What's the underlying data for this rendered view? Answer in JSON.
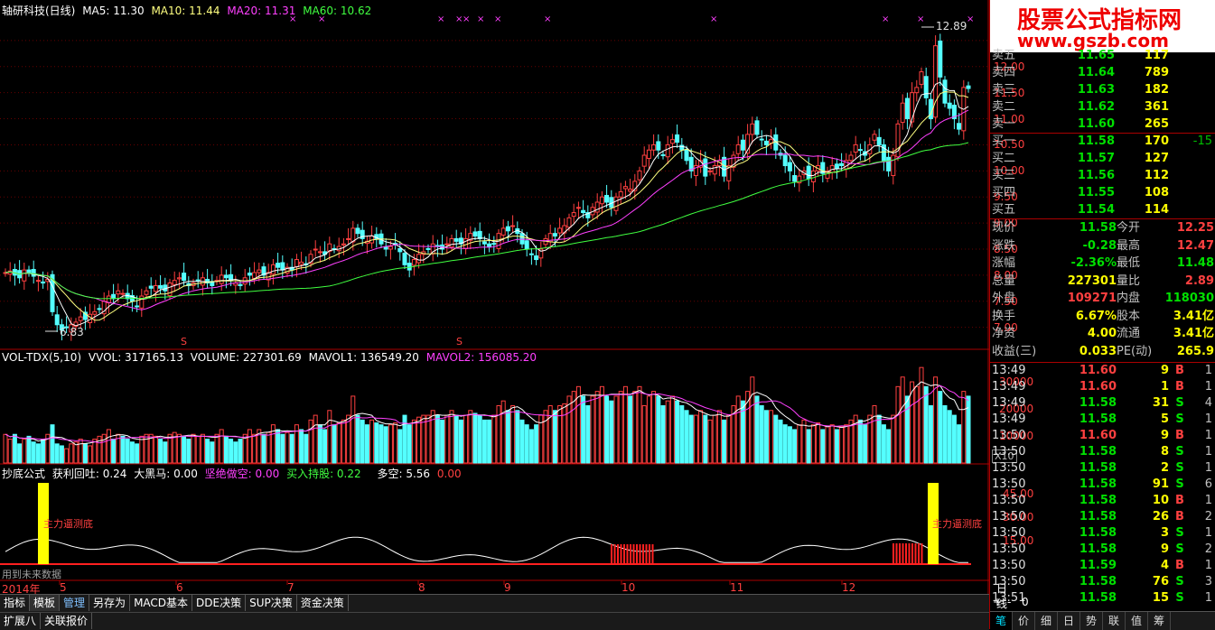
{
  "main_header": {
    "title": "轴研科技(日线)",
    "ma5": "MA5: 11.30",
    "ma10": "MA10: 11.44",
    "ma20": "MA20: 11.31",
    "ma60": "MA60: 10.62"
  },
  "vol_header": {
    "name": "VOL-TDX(5,10)",
    "vvol": "VVOL: 317165.13",
    "volume": "VOLUME: 227301.69",
    "mavol1": "MAVOL1: 136549.20",
    "mavol2": "MAVOL2: 156085.20"
  },
  "ind_header": {
    "name": "抄底公式",
    "profit": "获利回吐: 0.24",
    "black_horse": "大黑马: 0.00",
    "firm_short": "坚绝做空: 0.00",
    "buy_hold": "买入持股: 0.22",
    "long_short": "多空: 5.56",
    "zero": "0.00"
  },
  "labels": {
    "high": "12.89",
    "low": "6.83",
    "main_dip_left": "主力逼测底",
    "main_dip_right": "主力逼测底",
    "future_note": "用到未来数据",
    "x10": "X10",
    "period": "日线",
    "s_mark": "S"
  },
  "price_axis": [
    "12.50",
    "12.00",
    "11.50",
    "11.00",
    "10.50",
    "10.00",
    "9.50",
    "9.00",
    "8.50",
    "8.00",
    "7.50",
    "7.00"
  ],
  "price_axis_top": "1",
  "vol_axis": [
    "30000",
    "20000",
    "10000"
  ],
  "ind_axis": [
    "45.00",
    "30.00",
    "15.00"
  ],
  "time_axis": [
    "2014年",
    "5",
    "6",
    "7",
    "8",
    "9",
    "10",
    "11",
    "12"
  ],
  "tabs": [
    "指标",
    "模板",
    "管理",
    "另存为",
    "MACD基本",
    "DDE决策",
    "SUP决策",
    "资金决策"
  ],
  "tabs2": [
    "扩展八",
    "关联报价"
  ],
  "nav_controls": [
    "+",
    "-",
    "0"
  ],
  "watermark": {
    "line1": "股票公式指标网",
    "line2": "www.gszb.com"
  },
  "order_book": {
    "sell": [
      {
        "label": "卖五",
        "price": "11.65",
        "vol": "117"
      },
      {
        "label": "卖四",
        "price": "11.64",
        "vol": "789"
      },
      {
        "label": "卖三",
        "price": "11.63",
        "vol": "182"
      },
      {
        "label": "卖二",
        "price": "11.62",
        "vol": "361"
      },
      {
        "label": "卖一",
        "price": "11.60",
        "vol": "265"
      }
    ],
    "buy": [
      {
        "label": "买一",
        "price": "11.58",
        "vol": "170",
        "chg": "-15"
      },
      {
        "label": "买二",
        "price": "11.57",
        "vol": "127",
        "chg": ""
      },
      {
        "label": "买三",
        "price": "11.56",
        "vol": "112",
        "chg": ""
      },
      {
        "label": "买四",
        "price": "11.55",
        "vol": "108",
        "chg": ""
      },
      {
        "label": "买五",
        "price": "11.54",
        "vol": "114",
        "chg": ""
      }
    ]
  },
  "quote": [
    {
      "l1": "现价",
      "v1": "11.58",
      "l2": "今开",
      "v2": "12.25",
      "c1": "#00e000",
      "c2": "#ff4040"
    },
    {
      "l1": "涨跌",
      "v1": "-0.28",
      "l2": "最高",
      "v2": "12.47",
      "c1": "#00e000",
      "c2": "#ff4040"
    },
    {
      "l1": "涨幅",
      "v1": "-2.36%",
      "l2": "最低",
      "v2": "11.48",
      "c1": "#00e000",
      "c2": "#00e000"
    },
    {
      "l1": "总量",
      "v1": "227301",
      "l2": "量比",
      "v2": "2.89",
      "c1": "#ffff00",
      "c2": "#ff4040"
    },
    {
      "l1": "外盘",
      "v1": "109271",
      "l2": "内盘",
      "v2": "118030",
      "c1": "#ff4040",
      "c2": "#00e000"
    },
    {
      "l1": "换手",
      "v1": "6.67%",
      "l2": "股本",
      "v2": "3.41亿",
      "c1": "#ffff00",
      "c2": "#ffff00"
    },
    {
      "l1": "净资",
      "v1": "4.00",
      "l2": "流通",
      "v2": "3.41亿",
      "c1": "#ffff00",
      "c2": "#ffff00"
    },
    {
      "l1": "收益(三)",
      "v1": "0.033",
      "l2": "PE(动)",
      "v2": "265.9",
      "c1": "#ffff00",
      "c2": "#ffff00"
    }
  ],
  "ticks": [
    {
      "time": "13:49",
      "price": "11.60",
      "vol": "9",
      "side": "B",
      "cnt": "1"
    },
    {
      "time": "13:49",
      "price": "11.60",
      "vol": "1",
      "side": "B",
      "cnt": "1"
    },
    {
      "time": "13:49",
      "price": "11.58",
      "vol": "31",
      "side": "S",
      "cnt": "4"
    },
    {
      "time": "13:49",
      "price": "11.58",
      "vol": "5",
      "side": "S",
      "cnt": "1"
    },
    {
      "time": "13:50",
      "price": "11.60",
      "vol": "9",
      "side": "B",
      "cnt": "1"
    },
    {
      "time": "13:50",
      "price": "11.58",
      "vol": "8",
      "side": "S",
      "cnt": "1"
    },
    {
      "time": "13:50",
      "price": "11.58",
      "vol": "2",
      "side": "S",
      "cnt": "1"
    },
    {
      "time": "13:50",
      "price": "11.58",
      "vol": "91",
      "side": "S",
      "cnt": "6"
    },
    {
      "time": "13:50",
      "price": "11.58",
      "vol": "10",
      "side": "B",
      "cnt": "1"
    },
    {
      "time": "13:50",
      "price": "11.58",
      "vol": "26",
      "side": "B",
      "cnt": "2"
    },
    {
      "time": "13:50",
      "price": "11.58",
      "vol": "3",
      "side": "S",
      "cnt": "1"
    },
    {
      "time": "13:50",
      "price": "11.58",
      "vol": "9",
      "side": "S",
      "cnt": "2"
    },
    {
      "time": "13:50",
      "price": "11.59",
      "vol": "4",
      "side": "B",
      "cnt": "1"
    },
    {
      "time": "13:50",
      "price": "11.58",
      "vol": "76",
      "side": "S",
      "cnt": "3"
    },
    {
      "time": "13:51",
      "price": "11.58",
      "vol": "15",
      "side": "S",
      "cnt": "1"
    }
  ],
  "bottom_tabs": [
    "笔",
    "价",
    "细",
    "日",
    "势",
    "联",
    "值",
    "筹"
  ],
  "chart_data": {
    "type": "candlestick",
    "price_range": [
      6.7,
      13.0
    ],
    "closes": [
      8.05,
      8.08,
      8.0,
      7.95,
      8.1,
      8.05,
      7.98,
      7.9,
      7.85,
      7.92,
      7.3,
      7.05,
      6.95,
      7.0,
      7.05,
      7.1,
      7.2,
      7.15,
      7.25,
      7.3,
      7.35,
      7.5,
      7.6,
      7.55,
      7.7,
      7.65,
      7.55,
      7.5,
      7.4,
      7.6,
      7.7,
      7.75,
      7.8,
      7.75,
      7.7,
      7.85,
      7.9,
      7.95,
      7.9,
      7.8,
      7.85,
      7.9,
      7.95,
      7.85,
      7.8,
      7.9,
      8.0,
      7.95,
      7.9,
      7.85,
      7.8,
      7.95,
      8.0,
      8.05,
      8.1,
      8.0,
      8.05,
      8.2,
      8.15,
      8.1,
      8.15,
      8.1,
      8.3,
      8.25,
      8.2,
      8.4,
      8.5,
      8.45,
      8.4,
      8.6,
      8.5,
      8.55,
      8.6,
      8.7,
      8.9,
      8.8,
      8.7,
      8.65,
      8.75,
      8.7,
      8.6,
      8.5,
      8.55,
      8.6,
      8.45,
      8.2,
      8.1,
      8.3,
      8.4,
      8.45,
      8.5,
      8.6,
      8.55,
      8.5,
      8.6,
      8.7,
      8.65,
      8.6,
      8.7,
      8.8,
      8.75,
      8.7,
      8.6,
      8.55,
      8.6,
      8.8,
      8.9,
      8.85,
      8.95,
      8.8,
      8.6,
      8.5,
      8.4,
      8.3,
      8.5,
      8.7,
      8.8,
      8.75,
      8.9,
      8.95,
      9.1,
      9.2,
      9.3,
      9.2,
      9.1,
      9.3,
      9.4,
      9.5,
      9.4,
      9.3,
      9.5,
      9.6,
      9.7,
      9.65,
      9.8,
      10.0,
      10.3,
      10.4,
      10.5,
      10.4,
      10.3,
      10.5,
      10.6,
      10.55,
      10.4,
      10.2,
      10.0,
      10.1,
      10.2,
      9.9,
      10.0,
      10.1,
      10.2,
      9.9,
      10.1,
      10.3,
      10.5,
      10.4,
      10.7,
      10.9,
      10.7,
      10.6,
      10.5,
      10.6,
      10.4,
      10.3,
      10.1,
      10.0,
      9.8,
      9.9,
      10.0,
      9.85,
      10.0,
      10.1,
      9.95,
      10.0,
      10.1,
      10.05,
      10.1,
      10.2,
      10.3,
      10.5,
      10.4,
      10.3,
      10.5,
      10.7,
      10.5,
      10.2,
      10.0,
      10.3,
      10.9,
      11.3,
      11.0,
      11.5,
      11.6,
      11.9,
      11.4,
      11.0,
      12.4,
      11.8,
      11.3,
      11.2,
      11.0,
      10.8,
      11.6,
      11.58
    ],
    "series": [
      {
        "name": "VOLUME",
        "note": "relative 0-1 bars",
        "values": [
          0.3,
          0.25,
          0.3,
          0.2,
          0.25,
          0.28,
          0.22,
          0.2,
          0.25,
          0.3,
          0.4,
          0.2,
          0.18,
          0.15,
          0.2,
          0.22,
          0.25,
          0.2,
          0.18,
          0.25,
          0.28,
          0.3,
          0.35,
          0.25,
          0.3,
          0.28,
          0.25,
          0.22,
          0.2,
          0.28,
          0.3,
          0.3,
          0.28,
          0.25,
          0.22,
          0.3,
          0.32,
          0.3,
          0.28,
          0.25,
          0.3,
          0.28,
          0.3,
          0.25,
          0.22,
          0.3,
          0.35,
          0.28,
          0.25,
          0.22,
          0.25,
          0.3,
          0.35,
          0.3,
          0.35,
          0.3,
          0.32,
          0.4,
          0.35,
          0.3,
          0.32,
          0.3,
          0.4,
          0.35,
          0.3,
          0.45,
          0.5,
          0.4,
          0.35,
          0.55,
          0.4,
          0.42,
          0.45,
          0.5,
          0.7,
          0.5,
          0.45,
          0.4,
          0.45,
          0.42,
          0.4,
          0.38,
          0.4,
          0.42,
          0.35,
          0.5,
          0.4,
          0.45,
          0.48,
          0.5,
          0.5,
          0.55,
          0.5,
          0.45,
          0.5,
          0.55,
          0.5,
          0.45,
          0.5,
          0.55,
          0.52,
          0.5,
          0.45,
          0.45,
          0.5,
          0.6,
          0.65,
          0.55,
          0.6,
          0.55,
          0.45,
          0.4,
          0.35,
          0.4,
          0.5,
          0.55,
          0.6,
          0.55,
          0.6,
          0.62,
          0.7,
          0.75,
          0.8,
          0.7,
          0.6,
          0.7,
          0.75,
          0.8,
          0.7,
          0.65,
          0.7,
          0.75,
          0.8,
          0.7,
          0.75,
          0.8,
          0.6,
          0.7,
          0.75,
          0.7,
          0.6,
          0.65,
          0.7,
          0.65,
          0.6,
          0.55,
          0.5,
          0.5,
          0.55,
          0.5,
          0.45,
          0.5,
          0.55,
          0.45,
          0.5,
          0.6,
          0.7,
          0.65,
          0.75,
          0.9,
          0.7,
          0.6,
          0.55,
          0.55,
          0.5,
          0.45,
          0.4,
          0.38,
          0.35,
          0.4,
          0.45,
          0.35,
          0.4,
          0.42,
          0.35,
          0.38,
          0.4,
          0.35,
          0.38,
          0.4,
          0.45,
          0.5,
          0.45,
          0.4,
          0.5,
          0.6,
          0.5,
          0.4,
          0.35,
          0.5,
          0.8,
          0.9,
          0.7,
          0.85,
          0.8,
          1.0,
          0.8,
          0.6,
          0.9,
          0.75,
          0.6,
          0.55,
          0.5,
          0.4,
          0.75,
          0.7
        ]
      }
    ]
  }
}
